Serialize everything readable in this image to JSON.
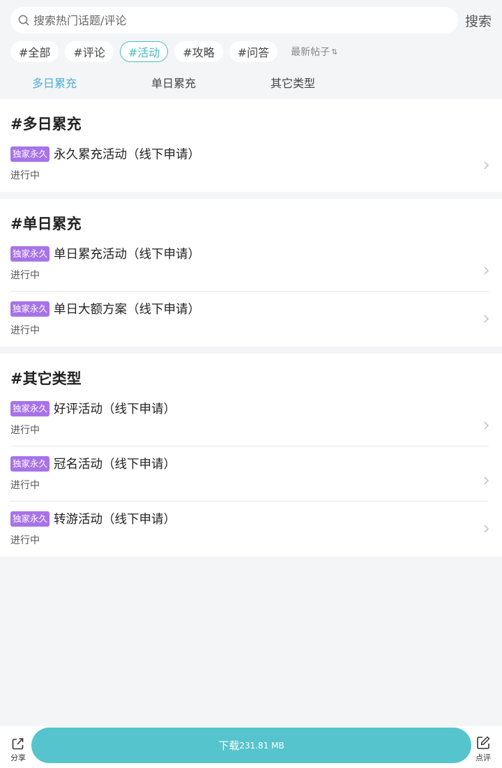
{
  "search": {
    "placeholder": "搜索热门话题/评论",
    "button_label": "搜索"
  },
  "tags": [
    {
      "label": "#全部",
      "active": false
    },
    {
      "label": "#评论",
      "active": false
    },
    {
      "label": "#活动",
      "active": true
    },
    {
      "label": "#攻略",
      "active": false
    },
    {
      "label": "#问答",
      "active": false
    }
  ],
  "sort": {
    "label": "最新帖子",
    "icon": "sort-arrows-icon"
  },
  "subtabs": [
    {
      "label": "多日累充",
      "active": true
    },
    {
      "label": "单日累充",
      "active": false
    },
    {
      "label": "其它类型",
      "active": false
    }
  ],
  "sections": [
    {
      "title": "#多日累充",
      "items": [
        {
          "badge": "独家永久",
          "title": "永久累充活动（线下申请）",
          "status": "进行中"
        }
      ]
    },
    {
      "title": "#单日累充",
      "items": [
        {
          "badge": "独家永久",
          "title": "单日累充活动（线下申请）",
          "status": "进行中"
        },
        {
          "badge": "独家永久",
          "title": "单日大额方案（线下申请）",
          "status": "进行中"
        }
      ]
    },
    {
      "title": "#其它类型",
      "items": [
        {
          "badge": "独家永久",
          "title": "好评活动（线下申请）",
          "status": "进行中"
        },
        {
          "badge": "独家永久",
          "title": "冠名活动（线下申请）",
          "status": "进行中"
        },
        {
          "badge": "独家永久",
          "title": "转游活动（线下申请）",
          "status": "进行中"
        }
      ]
    }
  ],
  "bottom_bar": {
    "share_label": "分享",
    "download_label": "下载",
    "download_size": "231.81 MB",
    "review_label": "点评"
  },
  "colors": {
    "accent": "#4bbec4",
    "tab_active": "#4bb0d6",
    "badge": "#a872e8",
    "download_button": "#56c4cc",
    "background": "#f4f5f7"
  }
}
